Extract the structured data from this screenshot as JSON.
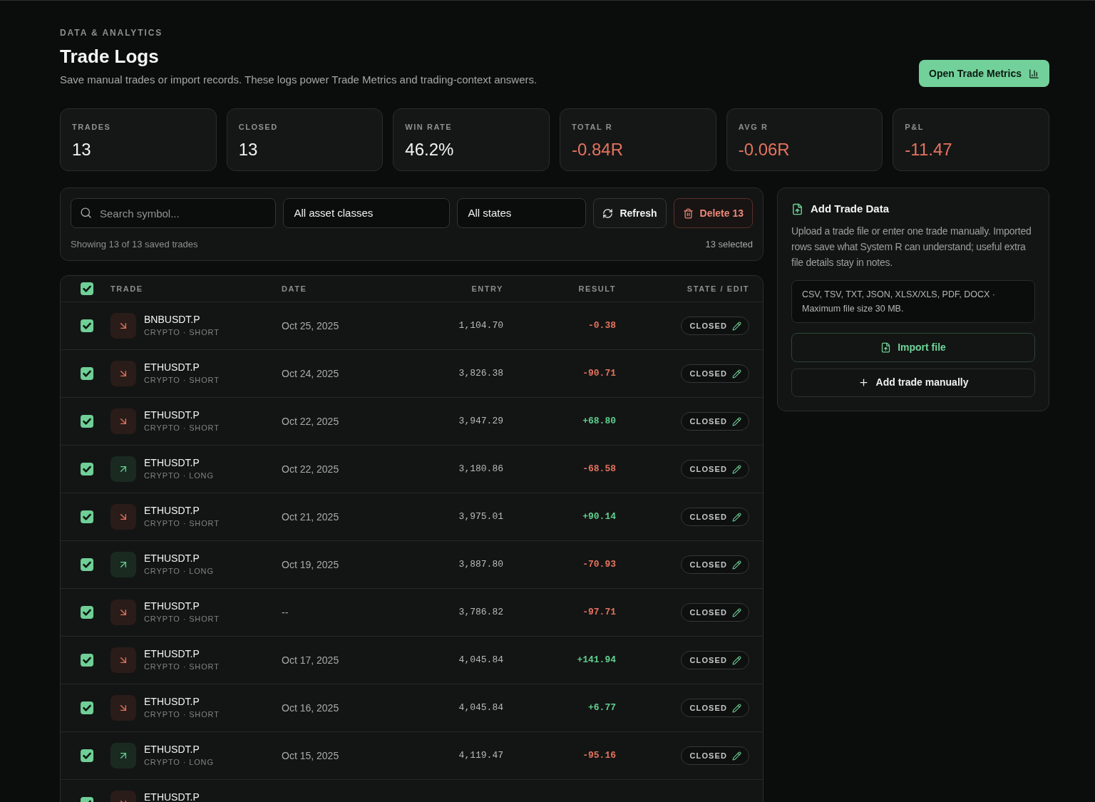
{
  "header": {
    "eyebrow": "DATA & ANALYTICS",
    "title": "Trade Logs",
    "description": "Save manual trades or import records. These logs power Trade Metrics and trading-context answers.",
    "action": {
      "label": "Open Trade Metrics"
    }
  },
  "stats": [
    {
      "label": "TRADES",
      "value": "13",
      "negative": false
    },
    {
      "label": "CLOSED",
      "value": "13",
      "negative": false
    },
    {
      "label": "WIN RATE",
      "value": "46.2%",
      "negative": false
    },
    {
      "label": "TOTAL R",
      "value": "-0.84R",
      "negative": true
    },
    {
      "label": "AVG R",
      "value": "-0.06R",
      "negative": true
    },
    {
      "label": "P&L",
      "value": "-11.47",
      "negative": true
    }
  ],
  "filters": {
    "search": {
      "placeholder": "Search symbol..."
    },
    "selects": [
      {
        "value": "All asset classes"
      },
      {
        "value": "All states"
      }
    ],
    "buttons": [
      {
        "kind": "refresh",
        "label": "Refresh"
      },
      {
        "kind": "delete",
        "label": "Delete 13"
      }
    ],
    "summary": "Showing 13 of 13 saved trades",
    "selection": "13 selected"
  },
  "trades": {
    "select_all": {
      "checked": true
    },
    "columns": [
      "TRADE",
      "DATE",
      "ENTRY",
      "RESULT",
      "STATE / EDIT"
    ],
    "rows": [
      {
        "checked": true,
        "short": true,
        "symbol": "BNBUSDT.P",
        "subtitle": "CRYPTO · SHORT",
        "date": "Oct 25, 2025",
        "entry": "1,104.70",
        "result": "-0.38",
        "negative": true,
        "state": "CLOSED"
      },
      {
        "checked": true,
        "short": true,
        "symbol": "ETHUSDT.P",
        "subtitle": "CRYPTO · SHORT",
        "date": "Oct 24, 2025",
        "entry": "3,826.38",
        "result": "-90.71",
        "negative": true,
        "state": "CLOSED"
      },
      {
        "checked": true,
        "short": true,
        "symbol": "ETHUSDT.P",
        "subtitle": "CRYPTO · SHORT",
        "date": "Oct 22, 2025",
        "entry": "3,947.29",
        "result": "+68.80",
        "negative": false,
        "state": "CLOSED"
      },
      {
        "checked": true,
        "short": false,
        "symbol": "ETHUSDT.P",
        "subtitle": "CRYPTO · LONG",
        "date": "Oct 22, 2025",
        "entry": "3,180.86",
        "result": "-68.58",
        "negative": true,
        "state": "CLOSED"
      },
      {
        "checked": true,
        "short": true,
        "symbol": "ETHUSDT.P",
        "subtitle": "CRYPTO · SHORT",
        "date": "Oct 21, 2025",
        "entry": "3,975.01",
        "result": "+90.14",
        "negative": false,
        "state": "CLOSED"
      },
      {
        "checked": true,
        "short": false,
        "symbol": "ETHUSDT.P",
        "subtitle": "CRYPTO · LONG",
        "date": "Oct 19, 2025",
        "entry": "3,887.80",
        "result": "-70.93",
        "negative": true,
        "state": "CLOSED"
      },
      {
        "checked": true,
        "short": true,
        "symbol": "ETHUSDT.P",
        "subtitle": "CRYPTO · SHORT",
        "date": "--",
        "entry": "3,786.82",
        "result": "-97.71",
        "negative": true,
        "state": "CLOSED"
      },
      {
        "checked": true,
        "short": true,
        "symbol": "ETHUSDT.P",
        "subtitle": "CRYPTO · SHORT",
        "date": "Oct 17, 2025",
        "entry": "4,045.84",
        "result": "+141.94",
        "negative": false,
        "state": "CLOSED"
      },
      {
        "checked": true,
        "short": true,
        "symbol": "ETHUSDT.P",
        "subtitle": "CRYPTO · SHORT",
        "date": "Oct 16, 2025",
        "entry": "4,045.84",
        "result": "+6.77",
        "negative": false,
        "state": "CLOSED"
      },
      {
        "checked": true,
        "short": false,
        "symbol": "ETHUSDT.P",
        "subtitle": "CRYPTO · LONG",
        "date": "Oct 15, 2025",
        "entry": "4,119.47",
        "result": "-95.16",
        "negative": true,
        "state": "CLOSED"
      },
      {
        "checked": true,
        "short": true,
        "symbol": "ETHUSDT.P"
      }
    ]
  },
  "add_panel": {
    "title": "Add Trade Data",
    "description": "Upload a trade file or enter one trade manually. Imported rows save what System R can understand; useful extra file details stay in notes.",
    "formats": "CSV, TSV, TXT, JSON, XLSX/XLS, PDF, DOCX · Maximum file size 30 MB.",
    "buttons": [
      {
        "kind": "import",
        "label": "Import file"
      },
      {
        "kind": "manual",
        "label": "Add trade manually"
      }
    ]
  }
}
